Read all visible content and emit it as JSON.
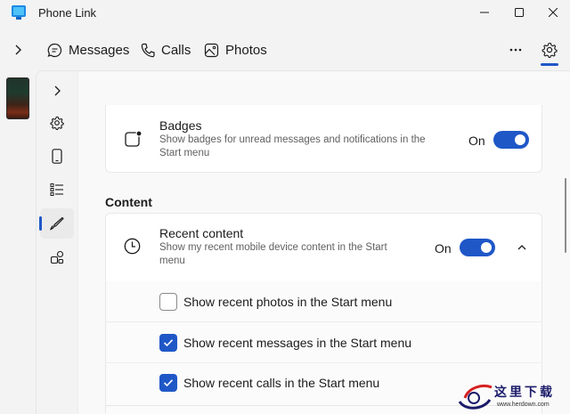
{
  "app": {
    "title": "Phone Link"
  },
  "window_controls": [
    "minimize-icon",
    "maximize-icon",
    "close-icon"
  ],
  "nav": {
    "tabs": [
      {
        "label": "Messages",
        "icon": "chat-bubble-icon"
      },
      {
        "label": "Calls",
        "icon": "phone-icon"
      },
      {
        "label": "Photos",
        "icon": "photos-icon"
      }
    ],
    "more_icon": "more-dots-icon",
    "settings_icon": "gear-icon"
  },
  "settings_rail": {
    "items": [
      "chevron-right-icon",
      "gear-icon",
      "mobile-device-icon",
      "features-list-icon",
      "brush-icon",
      "apps-icon"
    ],
    "active": "brush-icon"
  },
  "badges": {
    "title": "Badges",
    "description": "Show badges for unread messages and notifications in the Start menu",
    "toggle_label": "On",
    "toggle_on": true
  },
  "content_section": {
    "heading": "Content",
    "recent": {
      "title": "Recent content",
      "description": "Show my recent mobile device content in the Start menu",
      "toggle_label": "On",
      "toggle_on": true,
      "expanded": true
    },
    "options": [
      {
        "label": "Show recent photos in the Start menu",
        "checked": false
      },
      {
        "label": "Show recent messages in the Start menu",
        "checked": true
      },
      {
        "label": "Show recent calls in the Start menu",
        "checked": true
      }
    ]
  },
  "watermark": {
    "text": "这里下载",
    "url": "www.herdown.com"
  },
  "colors": {
    "accent": "#1f57c7",
    "background": "#f3f3f3",
    "card": "#ffffff"
  }
}
